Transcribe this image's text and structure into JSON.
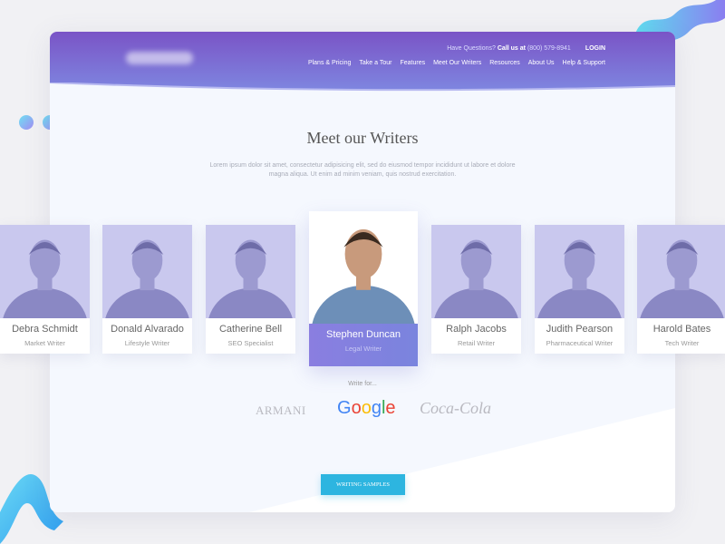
{
  "header": {
    "top_text": "Have Questions?",
    "call_label": "Call us at",
    "phone": "(800) 579-8941",
    "login": "LOGIN",
    "nav": [
      "Plans & Pricing",
      "Take a Tour",
      "Features",
      "Meet Our Writers",
      "Resources",
      "About Us",
      "Help & Support"
    ]
  },
  "main": {
    "title": "Meet our Writers",
    "lead": "Lorem ipsum dolor sit amet, consectetur adipisicing elit, sed do eiusmod tempor incididunt ut labore et dolore magna aliqua. Ut enim ad minim veniam, quis nostrud exercitation.",
    "writers": [
      {
        "name": "Debra Schmidt",
        "role": "Market Writer"
      },
      {
        "name": "Donald Alvarado",
        "role": "Lifestyle Writer"
      },
      {
        "name": "Catherine Bell",
        "role": "SEO Specialist"
      },
      {
        "name": "Stephen Duncan",
        "role": "Legal Writer",
        "active": true
      },
      {
        "name": "Ralph Jacobs",
        "role": "Retail Writer"
      },
      {
        "name": "Judith Pearson",
        "role": "Pharmaceutical Writer"
      },
      {
        "name": "Harold Bates",
        "role": "Tech Writer"
      }
    ],
    "write_for": "Write for...",
    "brands": [
      "ARMANI",
      "Google",
      "Coca-Cola"
    ],
    "cta": "WRITING SAMPLES"
  },
  "colors": {
    "header_start": "#7a54c6",
    "header_end": "#7e86e0",
    "accent": "#2db5e0",
    "photo_tint": "#c9c8ee"
  }
}
